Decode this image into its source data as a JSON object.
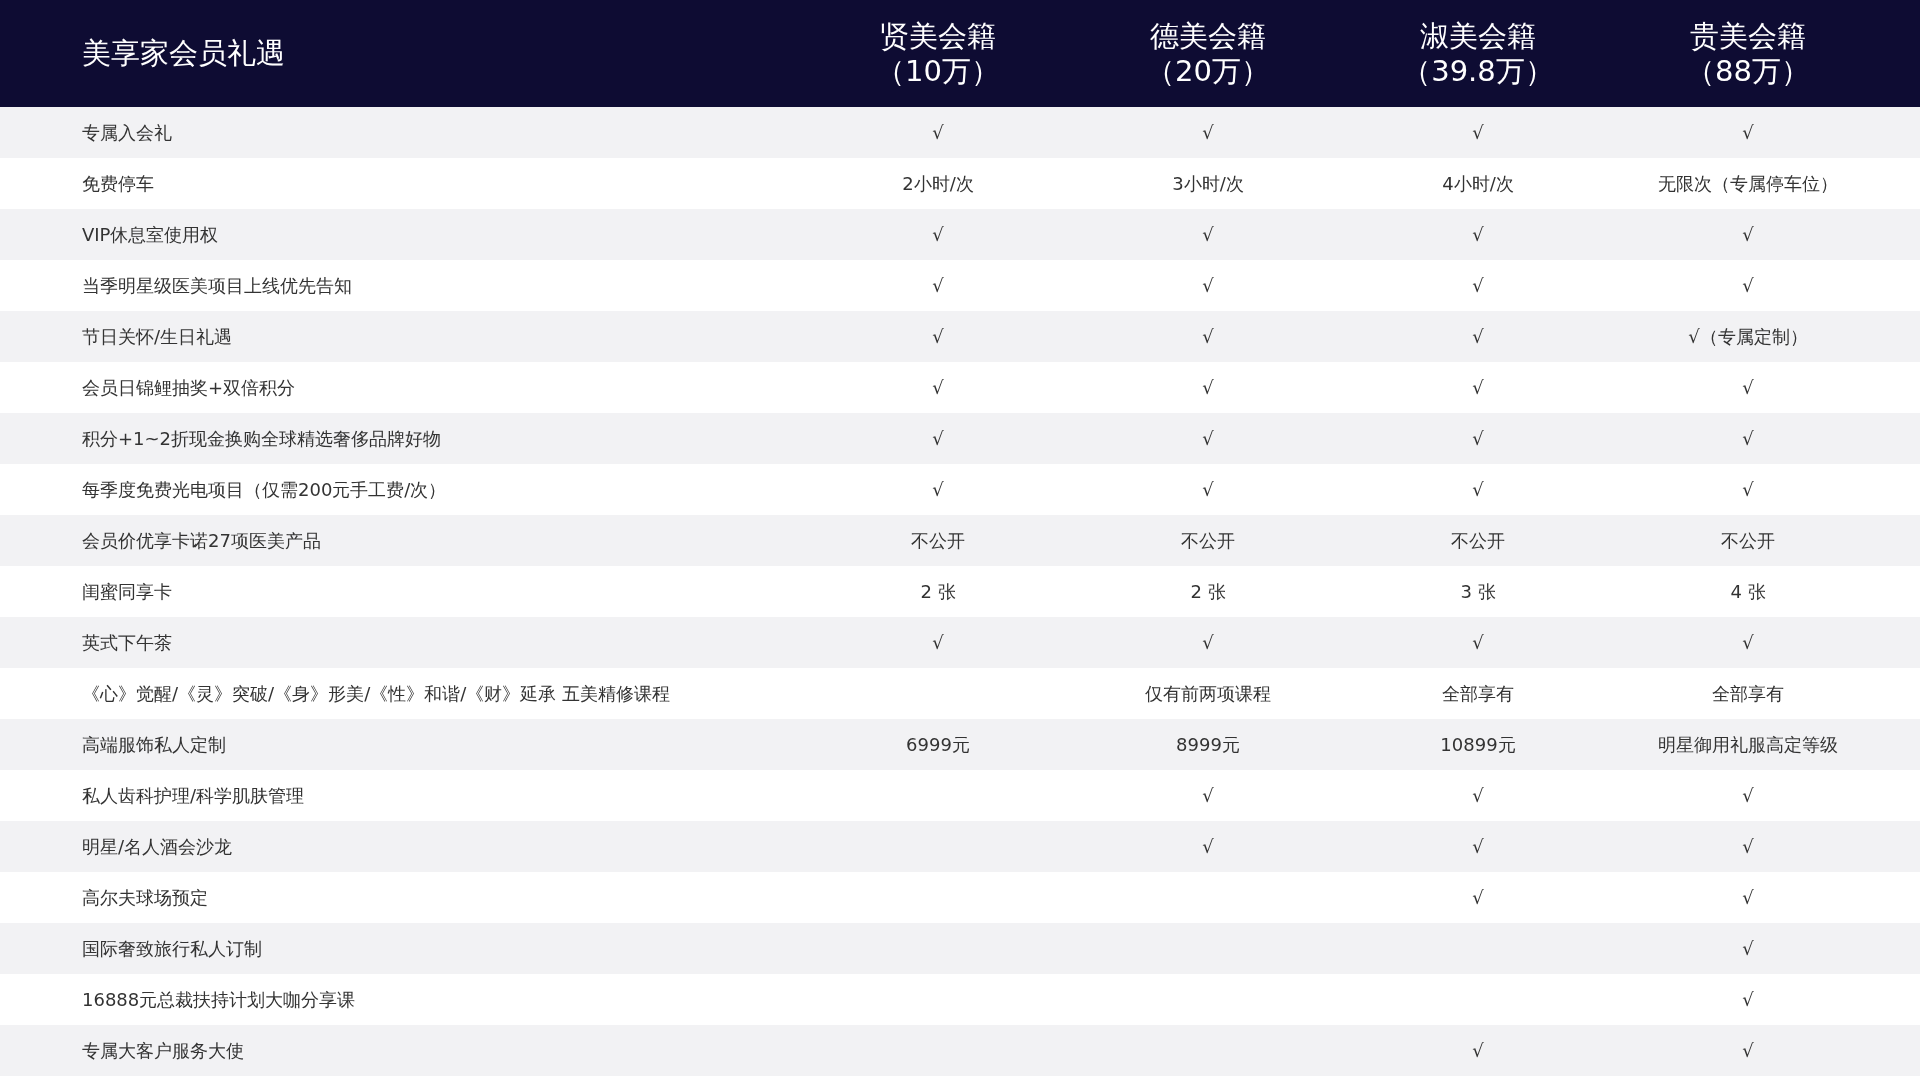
{
  "header": {
    "title": "美享家会员礼遇",
    "tiers": [
      {
        "name": "贤美会籍",
        "price": "（10万）"
      },
      {
        "name": "德美会籍",
        "price": "（20万）"
      },
      {
        "name": "淑美会籍",
        "price": "（39.8万）"
      },
      {
        "name": "贵美会籍",
        "price": "（88万）"
      }
    ]
  },
  "rows": [
    {
      "label": "专属入会礼",
      "cells": [
        "√",
        "√",
        "√",
        "√"
      ]
    },
    {
      "label": "免费停车",
      "cells": [
        "2小时/次",
        "3小时/次",
        "4小时/次",
        "无限次（专属停车位）"
      ]
    },
    {
      "label": "VIP休息室使用权",
      "cells": [
        "√",
        "√",
        "√",
        "√"
      ]
    },
    {
      "label": "当季明星级医美项目上线优先告知",
      "cells": [
        "√",
        "√",
        "√",
        "√"
      ]
    },
    {
      "label": "节日关怀/生日礼遇",
      "cells": [
        "√",
        "√",
        "√",
        "√（专属定制）"
      ]
    },
    {
      "label": "会员日锦鲤抽奖+双倍积分",
      "cells": [
        "√",
        "√",
        "√",
        "√"
      ]
    },
    {
      "label": "积分+1~2折现金换购全球精选奢侈品牌好物",
      "cells": [
        "√",
        "√",
        "√",
        "√"
      ]
    },
    {
      "label": "每季度免费光电项目（仅需200元手工费/次）",
      "cells": [
        "√",
        "√",
        "√",
        "√"
      ]
    },
    {
      "label": "会员价优享卡诺27项医美产品",
      "cells": [
        "不公开",
        "不公开",
        "不公开",
        "不公开"
      ]
    },
    {
      "label": "闺蜜同享卡",
      "cells": [
        "2 张",
        "2 张",
        "3 张",
        "4 张"
      ]
    },
    {
      "label": "英式下午茶",
      "cells": [
        "√",
        "√",
        "√",
        "√"
      ]
    },
    {
      "label": "《心》觉醒/《灵》突破/《身》形美/《性》和谐/《财》延承 五美精修课程",
      "cells": [
        null,
        "仅有前两项课程",
        "全部享有",
        "全部享有"
      ]
    },
    {
      "label": "高端服饰私人定制",
      "cells": [
        "6999元",
        "8999元",
        "10899元",
        "明星御用礼服高定等级"
      ]
    },
    {
      "label": "私人齿科护理/科学肌肤管理",
      "cells": [
        null,
        "√",
        "√",
        "√"
      ]
    },
    {
      "label": "明星/名人酒会沙龙",
      "cells": [
        null,
        "√",
        "√",
        "√"
      ]
    },
    {
      "label": "高尔夫球场预定",
      "cells": [
        null,
        null,
        "√",
        "√"
      ]
    },
    {
      "label": "国际奢致旅行私人订制",
      "cells": [
        null,
        null,
        null,
        "√"
      ]
    },
    {
      "label": "16888元总裁扶持计划大咖分享课",
      "cells": [
        null,
        null,
        null,
        "√"
      ]
    },
    {
      "label": "专属大客户服务大使",
      "cells": [
        null,
        null,
        "√",
        "√"
      ]
    }
  ]
}
